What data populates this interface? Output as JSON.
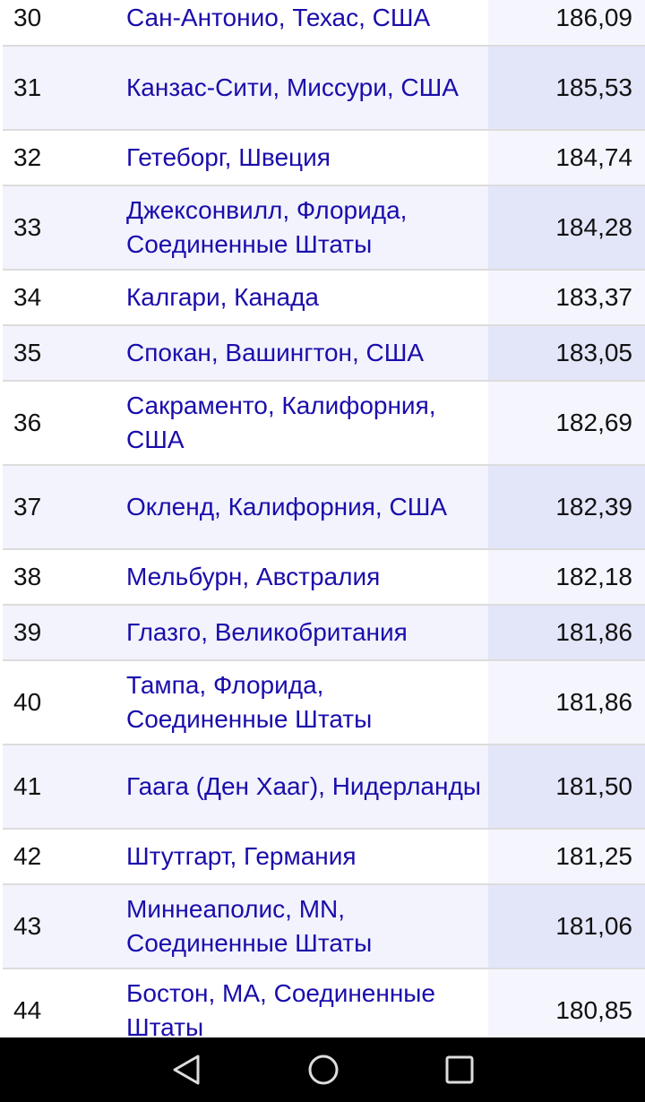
{
  "rows": [
    {
      "rank": "30",
      "city": "Сан-Антонио, Техас, США",
      "value": "186,09"
    },
    {
      "rank": "31",
      "city": "Канзас-Сити, Миссури, США",
      "value": "185,53"
    },
    {
      "rank": "32",
      "city": "Гетеборг, Швеция",
      "value": "184,74"
    },
    {
      "rank": "33",
      "city": "Джексонвилл, Флорида, Соединенные Штаты",
      "value": "184,28"
    },
    {
      "rank": "34",
      "city": "Калгари, Канада",
      "value": "183,37"
    },
    {
      "rank": "35",
      "city": "Спокан, Вашингтон, США",
      "value": "183,05"
    },
    {
      "rank": "36",
      "city": "Сакраменто, Калифорния, США",
      "value": "182,69"
    },
    {
      "rank": "37",
      "city": "Окленд, Калифорния, США",
      "value": "182,39"
    },
    {
      "rank": "38",
      "city": "Мельбурн, Австралия",
      "value": "182,18"
    },
    {
      "rank": "39",
      "city": "Глазго, Великобритания",
      "value": "181,86"
    },
    {
      "rank": "40",
      "city": "Тампа, Флорида, Соединенные Штаты",
      "value": "181,86"
    },
    {
      "rank": "41",
      "city": "Гаага (Ден Хааг), Нидерланды",
      "value": "181,50"
    },
    {
      "rank": "42",
      "city": "Штутгарт, Германия",
      "value": "181,25"
    },
    {
      "rank": "43",
      "city": "Миннеаполис, MN, Соединенные Штаты",
      "value": "181,06"
    },
    {
      "rank": "44",
      "city": "Бостон, MA, Соединенные Штаты",
      "value": "180,85"
    }
  ],
  "navbar": {
    "back": "back-icon",
    "home": "home-icon",
    "recents": "recents-icon"
  }
}
